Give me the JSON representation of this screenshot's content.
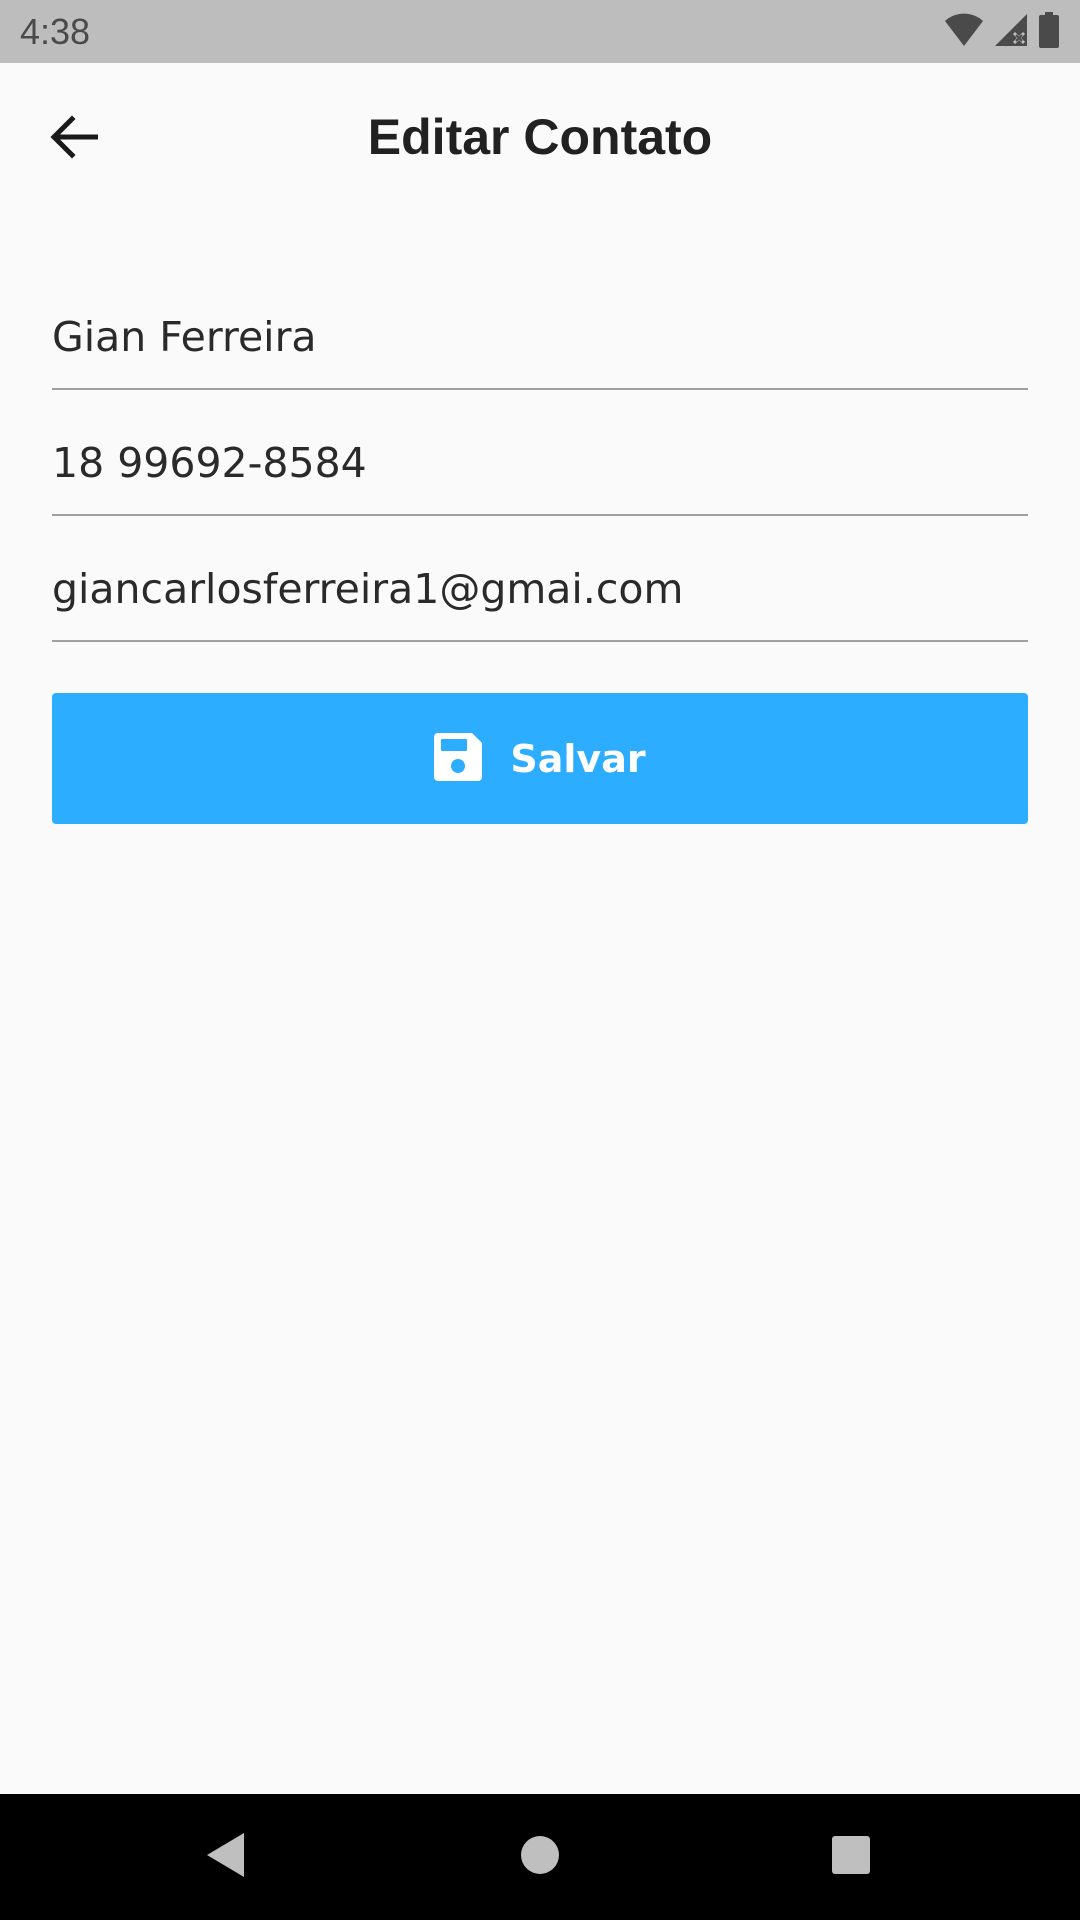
{
  "status_bar": {
    "time": "4:38",
    "icons": [
      "wifi-icon",
      "cell-signal-icon",
      "battery-icon"
    ]
  },
  "app_bar": {
    "title": "Editar Contato",
    "back_icon": "arrow-back-icon"
  },
  "form": {
    "name_value": "Gian Ferreira",
    "phone_value": "18 99692-8584",
    "email_value": "giancarlosferreira1@gmai.com"
  },
  "save_button": {
    "label": "Salvar",
    "icon": "floppy-disk-icon",
    "color": "#2cadff"
  },
  "nav_bar": {
    "icons": [
      "back-triangle-icon",
      "home-circle-icon",
      "recents-square-icon"
    ]
  }
}
